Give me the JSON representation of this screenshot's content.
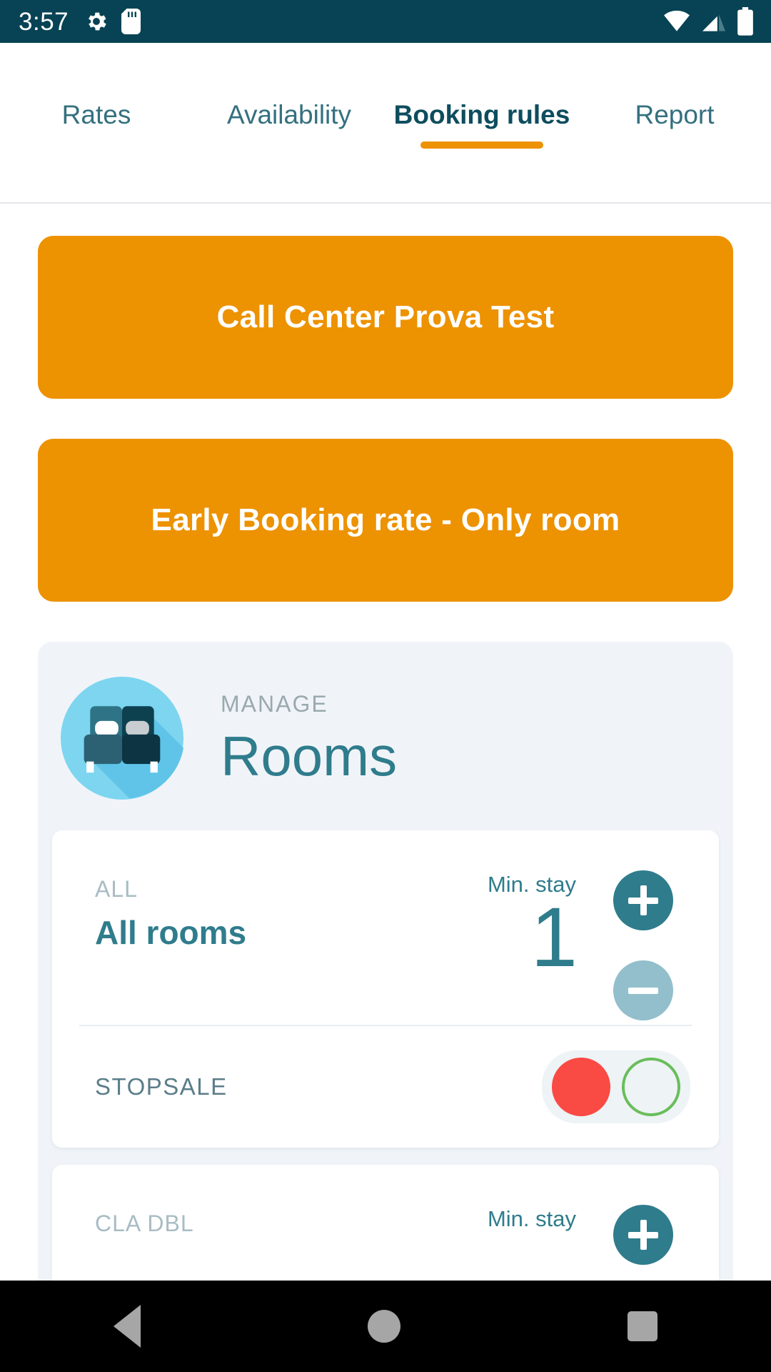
{
  "statusbar": {
    "time": "3:57",
    "icons": [
      "gear-icon",
      "sd-card-icon"
    ],
    "right_icons": [
      "wifi-icon",
      "signal-icon",
      "battery-icon"
    ],
    "background": "#074354"
  },
  "tabs": [
    {
      "label": "Rates",
      "active": false
    },
    {
      "label": "Availability",
      "active": false
    },
    {
      "label": "Booking rules",
      "active": true
    },
    {
      "label": "Report",
      "active": false
    }
  ],
  "accent": {
    "orange": "#ED9200",
    "teal": "#2F7C8C",
    "dark_teal": "#074354",
    "red": "#FA4A44",
    "green": "#69BE5B"
  },
  "banners": [
    {
      "label": "Call Center Prova Test"
    },
    {
      "label": "Early Booking rate - Only room"
    }
  ],
  "manage": {
    "kicker": "MANAGE",
    "title": "Rooms",
    "icon": "bed-icon"
  },
  "rooms": [
    {
      "code": "ALL",
      "name": "All rooms",
      "stay_label": "Min. stay",
      "stay_value": "1",
      "plus_label": "+",
      "minus_label": "-",
      "stopsale_label": "STOPSALE",
      "stopsale_selected": "red"
    },
    {
      "code": "CLA DBL",
      "name": "",
      "stay_label": "Min. stay",
      "stay_value": "",
      "plus_label": "+"
    }
  ],
  "navbar": {
    "back": "back-icon",
    "home": "home-icon",
    "recent": "recents-icon"
  }
}
